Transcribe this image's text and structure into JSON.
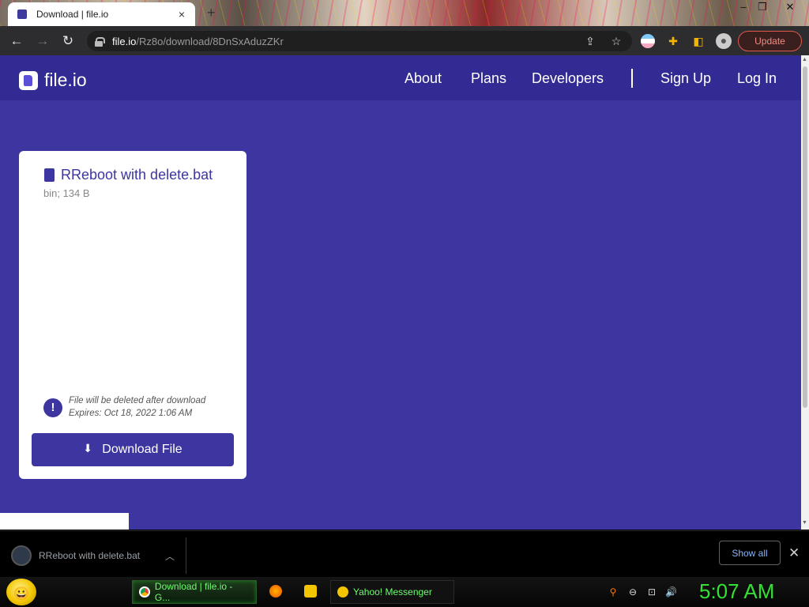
{
  "browser": {
    "tab_title": "Download | file.io",
    "tab_close": "×",
    "new_tab": "+",
    "window_controls": {
      "minimize": "–",
      "restore": "❐",
      "close": "✕"
    },
    "url_host": "file.io",
    "url_path": "/Rz8o/download/8DnSxAduzZKr",
    "update_label": "Update"
  },
  "site": {
    "logo_text": "file.io",
    "nav": {
      "about": "About",
      "plans": "Plans",
      "developers": "Developers",
      "sign_up": "Sign Up",
      "log_in": "Log In"
    },
    "card": {
      "file_name": "RReboot with delete.bat",
      "file_meta": "bin; 134 B",
      "info_glyph": "!",
      "note_delete": "File will be deleted after download",
      "note_expires": "Expires: Oct 18, 2022 1:06 AM",
      "download_label": "Download File"
    }
  },
  "download_shelf": {
    "file_name": "RReboot with delete.bat",
    "show_all": "Show all",
    "close": "✕"
  },
  "taskbar": {
    "chrome_task": "Download | file.io - G...",
    "yahoo_task": "Yahoo! Messenger",
    "clock": "5:07 AM"
  },
  "colors": {
    "page_bg": "#3d35a0",
    "nav_bg": "#322b93",
    "accent": "#3d35a0",
    "update_red": "#e2574c",
    "clock_green": "#35e035"
  }
}
